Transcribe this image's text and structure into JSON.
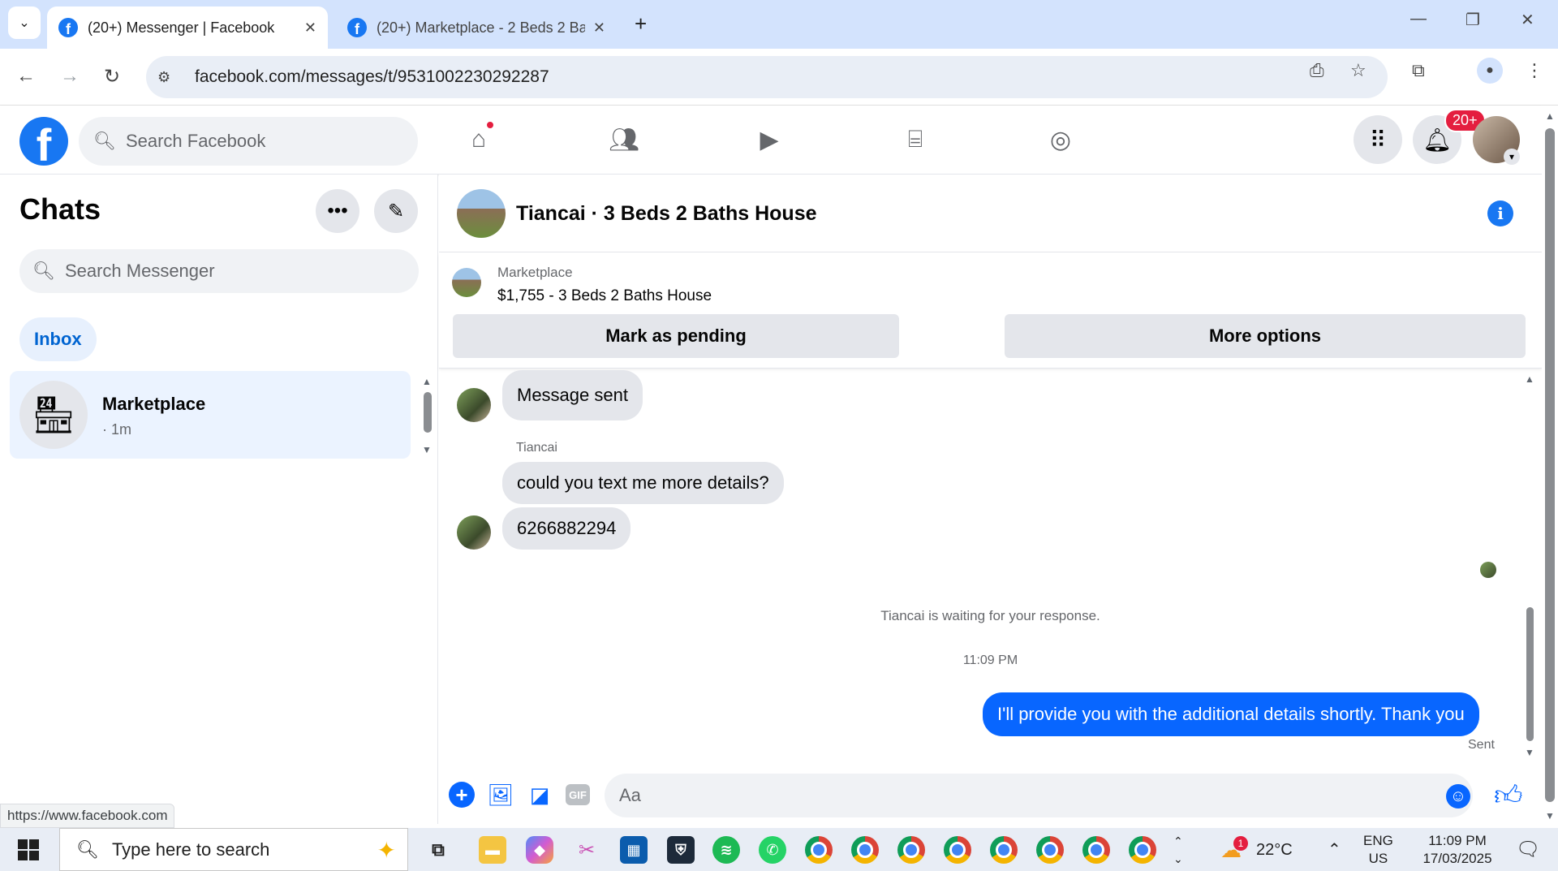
{
  "browser": {
    "tabs": [
      {
        "title": "(20+) Messenger | Facebook",
        "active": true
      },
      {
        "title": "(20+) Marketplace - 2 Beds 2 Ba",
        "active": false
      }
    ],
    "url": "facebook.com/messages/t/9531002230292287",
    "status_url": "https://www.facebook.com"
  },
  "facebook": {
    "search_placeholder": "Search Facebook",
    "notification_badge": "20+"
  },
  "chats": {
    "title": "Chats",
    "search_placeholder": "Search Messenger",
    "filter": "Inbox",
    "threads": [
      {
        "name": "Marketplace",
        "time": "· 1m"
      }
    ]
  },
  "conversation": {
    "title": "Tiancai · 3 Beds 2 Baths House",
    "marketplace_label": "Marketplace",
    "listing": "$1,755 - 3 Beds 2 Baths House",
    "mark_pending": "Mark as pending",
    "more_options": "More options",
    "messages": {
      "m1": "Message sent",
      "sender": "Tiancai",
      "m2": "could you text me more details?",
      "m3": "6266882294",
      "waiting": "Tiancai is waiting for your response.",
      "timestamp": "11:09 PM",
      "m4": "I'll provide you with the additional details shortly. Thank you",
      "sent": "Sent"
    },
    "composer_placeholder": "Aa",
    "gif_label": "GIF"
  },
  "taskbar": {
    "search_placeholder": "Type here to search",
    "weather": "22°C",
    "weather_badge": "1",
    "lang_top": "ENG",
    "lang_bottom": "US",
    "time": "11:09 PM",
    "date": "17/03/2025"
  },
  "colors": {
    "brand": "#1877f2",
    "outgoing_bubble": "#0866ff",
    "badge": "#e41e3f"
  }
}
